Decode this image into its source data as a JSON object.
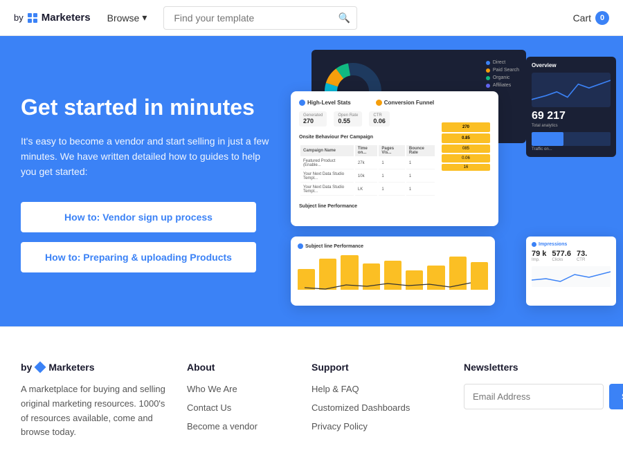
{
  "header": {
    "logo_by": "by",
    "logo_marketers": "Marketers",
    "browse_label": "Browse",
    "search_placeholder": "Find your template",
    "cart_label": "Cart",
    "cart_count": "0"
  },
  "hero": {
    "title": "Get started in minutes",
    "description": "It's easy to become a vendor and start selling in just a few minutes. We have written detailed how to guides to help you get started:",
    "btn1_label": "How to: Vendor sign up process",
    "btn2_label": "How to: Preparing & uploading Products"
  },
  "footer": {
    "logo_by": "by",
    "logo_marketers": "Marketers",
    "desc": "A marketplace for buying and selling original marketing resources.  1000's of resources available, come and browse today.",
    "about": {
      "title": "About",
      "links": [
        "Who We Are",
        "Contact Us",
        "Become a vendor"
      ]
    },
    "support": {
      "title": "Support",
      "links": [
        "Help & FAQ",
        "Customized Dashboards",
        "Privacy Policy"
      ]
    },
    "newsletter": {
      "title": "Newsletters",
      "email_placeholder": "Email Address",
      "subscribe_label": "Subscribe"
    }
  },
  "mockup": {
    "donut_legend": [
      {
        "label": "Direct",
        "color": "#3b82f6"
      },
      {
        "label": "Paid Search",
        "color": "#f59e0b"
      },
      {
        "label": "Organic",
        "color": "#10b981"
      },
      {
        "label": "Affiliates",
        "color": "#6366f1"
      }
    ],
    "stats": {
      "generated": "270",
      "open_rate": "0.55",
      "ctr": "0.06"
    },
    "overview_number": "69 217",
    "impressions": {
      "val1": "79 k",
      "val2": "577.6",
      "val3": "73."
    }
  }
}
